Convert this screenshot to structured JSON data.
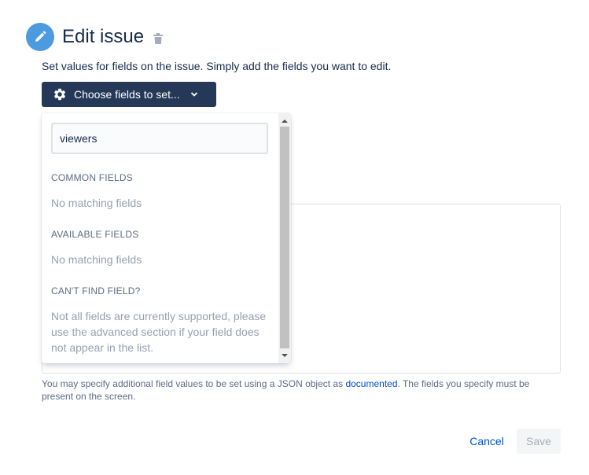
{
  "header": {
    "title": "Edit issue",
    "icon": "pencil-icon",
    "delete_icon": "trash-icon",
    "accent_color": "#4c9ae0"
  },
  "subtitle": "Set values for fields on the issue. Simply add the fields you want to edit.",
  "choose_button": {
    "label": "Choose fields to set...",
    "icon": "gear-icon",
    "caret_icon": "chevron-down-icon",
    "bg_color": "#253858"
  },
  "dropdown": {
    "search_value": "viewers",
    "common_fields_heading": "COMMON FIELDS",
    "common_fields_empty": "No matching fields",
    "available_fields_heading": "AVAILABLE FIELDS",
    "available_fields_empty": "No matching fields",
    "cant_find_heading": "CAN'T FIND FIELD?",
    "cant_find_text": "Not all fields are currently supported, please use the advanced section if your field does not appear in the list."
  },
  "help": {
    "before": "You may specify additional field values to be set using a JSON object as ",
    "link": "documented",
    "after": ". The fields you specify must be present on the screen."
  },
  "footer": {
    "cancel_label": "Cancel",
    "save_label": "Save"
  }
}
